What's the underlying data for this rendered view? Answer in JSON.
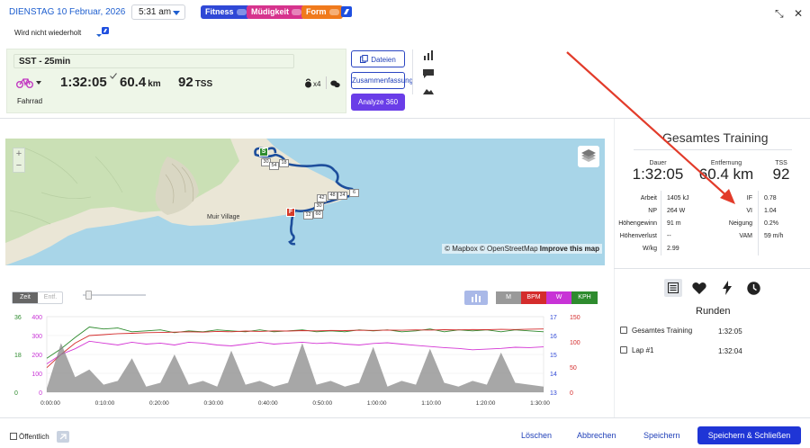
{
  "header": {
    "date": "DIENSTAG 10 Februar, 2026",
    "time": "5:31 am",
    "tags": [
      {
        "label": "Fitness",
        "color": "#2f48d6"
      },
      {
        "label": "Müdigkeit",
        "color": "#d6338d"
      },
      {
        "label": "Form",
        "color": "#f07a1c"
      }
    ],
    "repeat": "Wird nicht wiederholt"
  },
  "summary": {
    "title": "SST - 25min",
    "duration": "1:32:05",
    "distance": "60.4",
    "distance_unit": "km",
    "tss": "92",
    "tss_unit": "TSS",
    "sport": "Fahrrad",
    "badge_count": "x4"
  },
  "actions": {
    "files": "Dateien",
    "summary": "Zusammenfassung",
    "analyze": "Analyze 360"
  },
  "map": {
    "credit_mapbox": "© Mapbox",
    "credit_osm": "© OpenStreetMap",
    "credit_improve": "Improve this map",
    "village": "Muir Village",
    "start_marker": "S",
    "finish_marker": "F",
    "km_markers": [
      "30",
      "54",
      "18",
      "6",
      "24",
      "48",
      "42",
      "30",
      "12",
      "60"
    ]
  },
  "totals": {
    "title": "Gesamtes Training",
    "duration_label": "Dauer",
    "duration": "1:32:05",
    "distance_label": "Entfernung",
    "distance": "60.4 km",
    "tss_label": "TSS",
    "tss": "92",
    "left_rows": [
      {
        "label": "Arbeit",
        "value": "1405 kJ"
      },
      {
        "label": "NP",
        "value": "264 W"
      },
      {
        "label": "Höhengewinn",
        "value": "91 m"
      },
      {
        "label": "Höhenverlust",
        "value": "--"
      },
      {
        "label": "W/kg",
        "value": "2.99"
      }
    ],
    "right_rows": [
      {
        "label": "IF",
        "value": "0.78"
      },
      {
        "label": "VI",
        "value": "1.04"
      },
      {
        "label": "Neigung",
        "value": "0.2%"
      },
      {
        "label": "VAM",
        "value": "59 m/h"
      }
    ]
  },
  "chart_toolbar": {
    "time": "Zeit",
    "distance": "Entf.",
    "m": "M",
    "bpm": "BPM",
    "w": "W",
    "kph": "KPH"
  },
  "chart_data": {
    "type": "line",
    "x_ticks": [
      "0:00:00",
      "0:10:00",
      "0:20:00",
      "0:30:00",
      "0:40:00",
      "0:50:00",
      "1:00:00",
      "1:10:00",
      "1:20:00",
      "1:30:00"
    ],
    "y_left_outer_ticks": [
      "36",
      "18",
      "0"
    ],
    "y_left_ticks": [
      "400",
      "300",
      "200",
      "100",
      "0"
    ],
    "y_right_inner_ticks": [
      "17",
      "16",
      "15",
      "14",
      "13"
    ],
    "y_right_outer_ticks": [
      "150",
      "100",
      "50",
      "0"
    ],
    "series": [
      {
        "color": "#2e8b2e",
        "ylim": [
          0,
          400
        ],
        "values": [
          180,
          230,
          290,
          345,
          335,
          340,
          320,
          325,
          330,
          315,
          325,
          320,
          330,
          325,
          320,
          330,
          320,
          325,
          330,
          320,
          325,
          320,
          330,
          325,
          330,
          320,
          325,
          335,
          320,
          330,
          325,
          330,
          320,
          330,
          325,
          320
        ]
      },
      {
        "color": "#d42c2c",
        "ylim": [
          0,
          400
        ],
        "values": [
          130,
          200,
          260,
          300,
          305,
          310,
          312,
          315,
          316,
          318,
          320,
          318,
          322,
          320,
          324,
          322,
          325,
          324,
          326,
          325,
          327,
          326,
          328,
          327,
          329,
          328,
          330,
          329,
          331,
          330,
          332,
          331,
          333,
          332,
          334,
          335
        ]
      },
      {
        "color": "#d436d4",
        "ylim": [
          0,
          400
        ],
        "values": [
          150,
          200,
          230,
          270,
          260,
          250,
          265,
          255,
          260,
          250,
          265,
          260,
          250,
          245,
          255,
          265,
          255,
          260,
          265,
          258,
          262,
          255,
          250,
          258,
          262,
          255,
          248,
          242,
          236,
          232,
          225,
          228,
          232,
          238,
          236,
          240
        ]
      },
      {
        "color": "#8a8a8a",
        "ylim": [
          0,
          400
        ],
        "values": [
          20,
          260,
          80,
          120,
          40,
          60,
          180,
          30,
          50,
          200,
          40,
          60,
          30,
          220,
          40,
          60,
          30,
          50,
          260,
          40,
          60,
          30,
          50,
          240,
          30,
          60,
          40,
          230,
          50,
          30,
          60,
          40,
          210,
          50,
          40,
          30
        ]
      }
    ]
  },
  "rounds": {
    "icons": [
      "list-icon",
      "heart-icon",
      "bolt-icon",
      "clock-icon"
    ],
    "title": "Runden",
    "items": [
      {
        "label": "Gesamtes Training",
        "time": "1:32:05"
      },
      {
        "label": "Lap #1",
        "time": "1:32:04"
      }
    ]
  },
  "footer": {
    "public": "Öffentlich",
    "delete": "Löschen",
    "cancel": "Abbrechen",
    "save": "Speichern",
    "save_close": "Speichern & Schließen"
  }
}
